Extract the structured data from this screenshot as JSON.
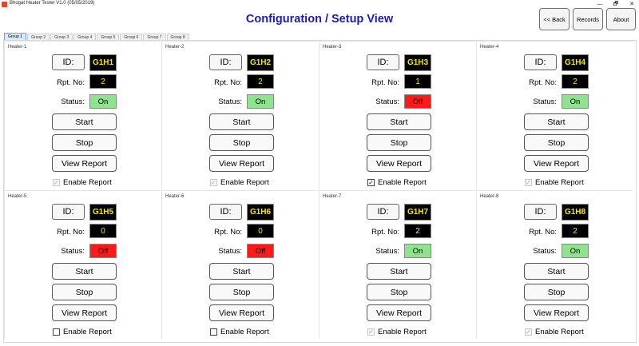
{
  "window": {
    "title": "Bhogat Heater Tester V1.0 (05/05/2019)",
    "minimize": "—",
    "maximize": "🗗",
    "close": "✕"
  },
  "header": {
    "title": "Configuration / Setup View",
    "back_label": "<< Back",
    "records_label": "Records",
    "about_label": "About"
  },
  "tabs": [
    {
      "label": "Group 1",
      "active": true
    },
    {
      "label": "Group 2",
      "active": false
    },
    {
      "label": "Group 3",
      "active": false
    },
    {
      "label": "Group 4",
      "active": false
    },
    {
      "label": "Group 5",
      "active": false
    },
    {
      "label": "Group 6",
      "active": false
    },
    {
      "label": "Group 7",
      "active": false
    },
    {
      "label": "Group 8",
      "active": false
    }
  ],
  "labels": {
    "id": "ID:",
    "rpt_no": "Rpt. No:",
    "status": "Status:",
    "start": "Start",
    "stop": "Stop",
    "view_report": "View Report",
    "enable_report": "Enable Report"
  },
  "colors": {
    "status_on": "#8fe38f",
    "status_off": "#ff1a1a",
    "value_text": "#f7e900",
    "title": "#1c1ab8"
  },
  "heaters": [
    {
      "name": "Heater-1",
      "id": "G1H1",
      "rpt": "2",
      "status": "On",
      "enable_report": true,
      "enable_disabled": true
    },
    {
      "name": "Heater-2",
      "id": "G1H2",
      "rpt": "2",
      "status": "On",
      "enable_report": true,
      "enable_disabled": true
    },
    {
      "name": "Heater-3",
      "id": "G1H3",
      "rpt": "1",
      "status": "Off",
      "enable_report": true,
      "enable_disabled": false
    },
    {
      "name": "Heater-4",
      "id": "G1H4",
      "rpt": "2",
      "status": "On",
      "enable_report": true,
      "enable_disabled": true
    },
    {
      "name": "Heater-5",
      "id": "G1H5",
      "rpt": "0",
      "status": "Off",
      "enable_report": false,
      "enable_disabled": false
    },
    {
      "name": "Heater-6",
      "id": "G1H6",
      "rpt": "0",
      "status": "Off",
      "enable_report": false,
      "enable_disabled": false
    },
    {
      "name": "Heater-7",
      "id": "G1H7",
      "rpt": "2",
      "status": "On",
      "enable_report": true,
      "enable_disabled": true
    },
    {
      "name": "Heater-8",
      "id": "G1H8",
      "rpt": "2",
      "status": "On",
      "enable_report": true,
      "enable_disabled": true
    }
  ]
}
